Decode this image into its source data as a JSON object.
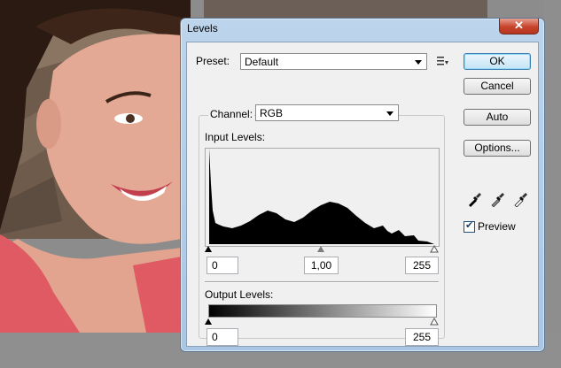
{
  "dialog": {
    "title": "Levels",
    "close_label": "✕",
    "preset_label": "Preset:",
    "preset_value": "Default",
    "channel_label": "Channel:",
    "channel_value": "RGB",
    "input_levels_label": "Input Levels:",
    "output_levels_label": "Output Levels:",
    "input_black": "0",
    "input_gamma": "1,00",
    "input_white": "255",
    "output_black": "0",
    "output_white": "255",
    "buttons": {
      "ok": "OK",
      "cancel": "Cancel",
      "auto": "Auto",
      "options": "Options..."
    },
    "preview_label": "Preview",
    "preview_checked": true
  },
  "icons": {
    "preset_menu": "preset-options-icon",
    "eyedroppers": [
      "black-eyedropper-icon",
      "gray-eyedropper-icon",
      "white-eyedropper-icon"
    ]
  }
}
